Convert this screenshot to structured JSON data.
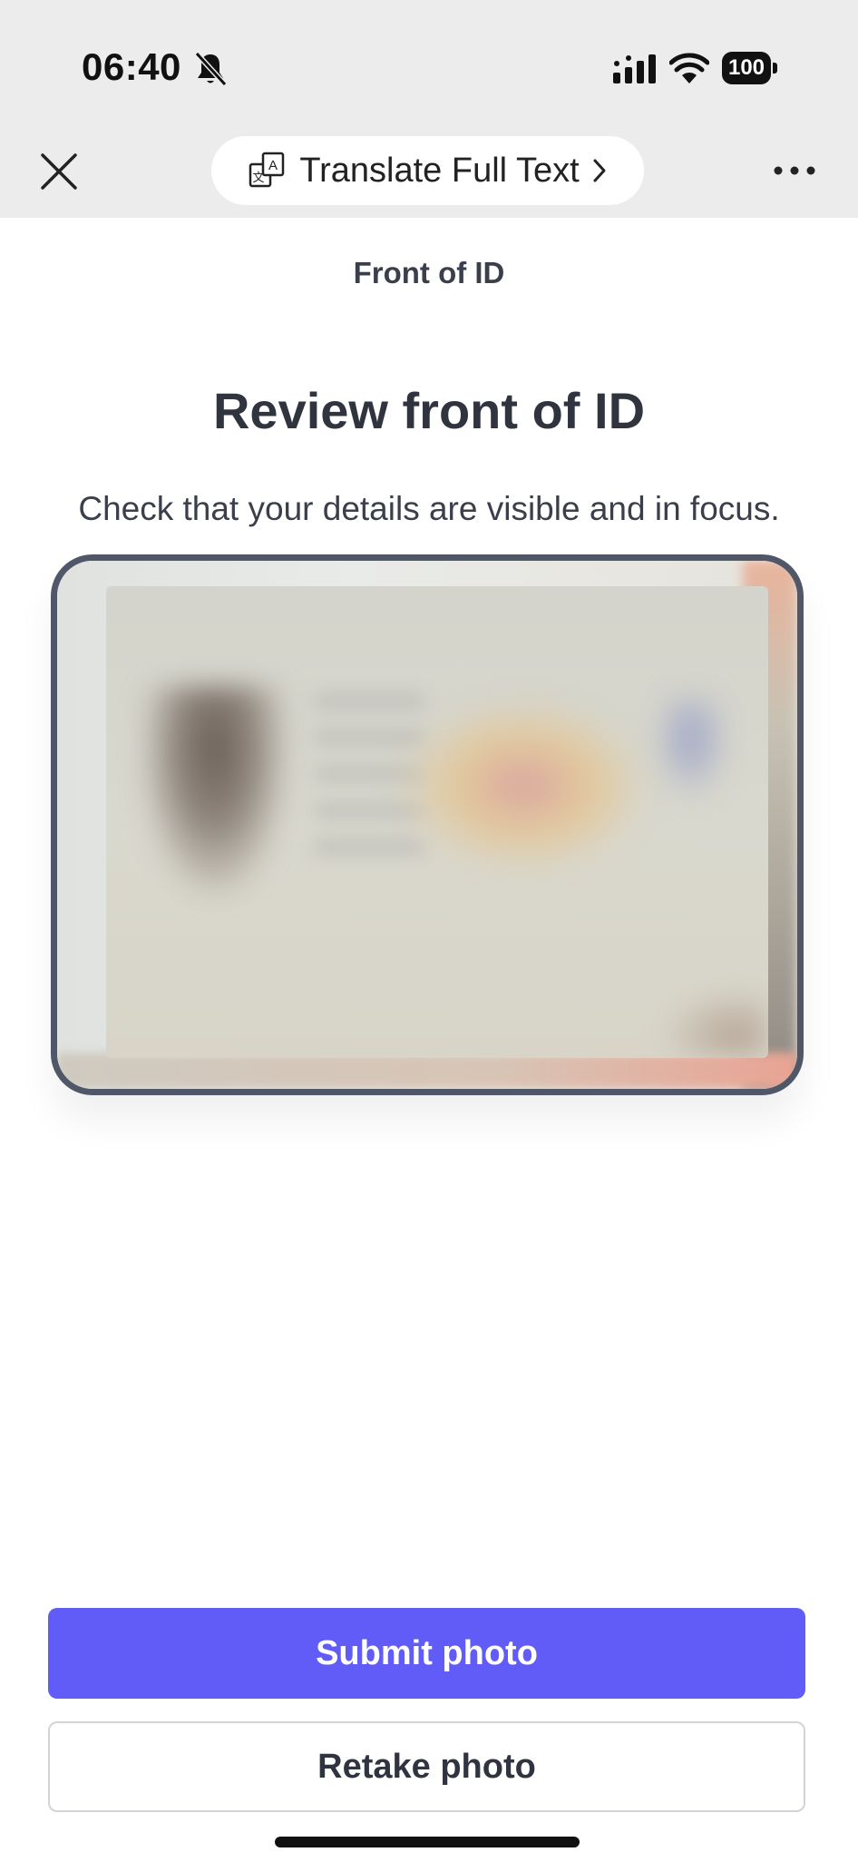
{
  "status_bar": {
    "time": "06:40",
    "battery": "100",
    "icons": [
      "bell-slash-icon",
      "signal-icon",
      "wifi-icon",
      "battery-icon"
    ]
  },
  "browser_bar": {
    "translate_label": "Translate Full Text",
    "icons": [
      "close-icon",
      "translate-icon",
      "chevron-right-icon",
      "more-icon"
    ]
  },
  "main": {
    "step_label": "Front of ID",
    "title": "Review front of ID",
    "subtitle": "Check that your details are visible and in focus."
  },
  "actions": {
    "submit_label": "Submit photo",
    "retake_label": "Retake photo"
  },
  "colors": {
    "primary": "#615bf7",
    "frame_border": "#4f5768",
    "chrome_bg": "#ececec"
  }
}
